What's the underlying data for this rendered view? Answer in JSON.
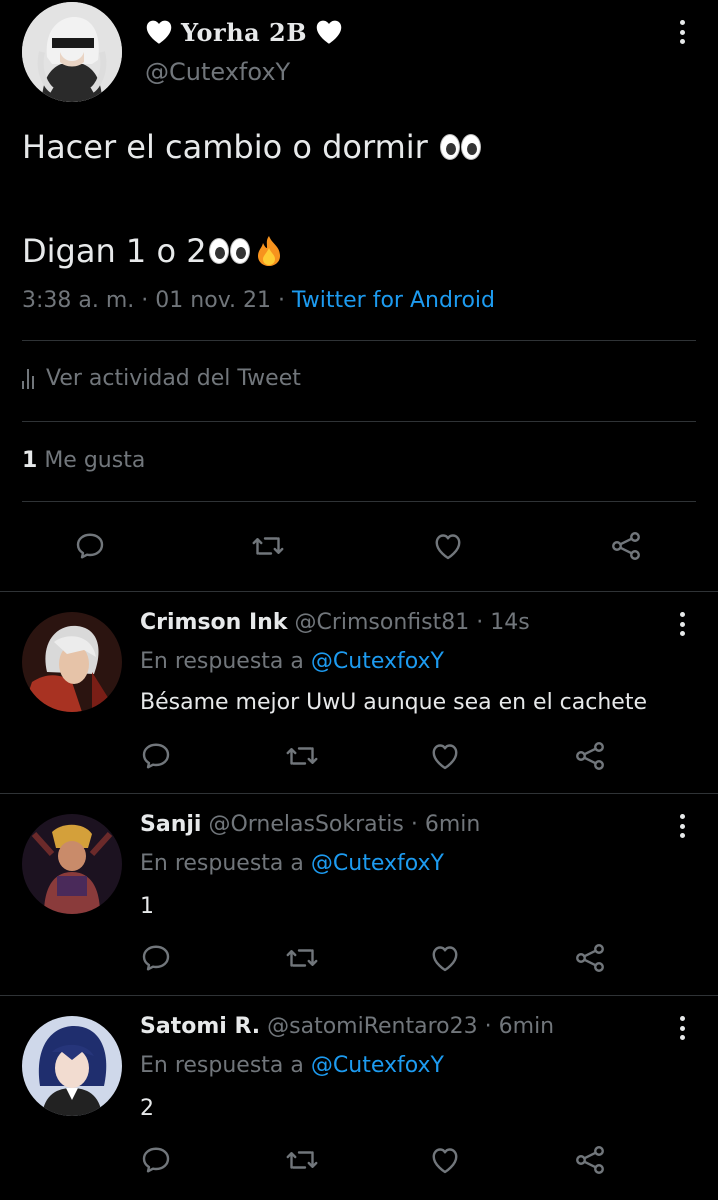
{
  "main_tweet": {
    "display_name": "Yorha 2B",
    "handle": "@CutexfoxY",
    "text_line1": "Hacer el cambio o dormir",
    "text_line2": "Digan 1 o 2",
    "time": "3:38 a. m.",
    "date": "01 nov. 21",
    "source": "Twitter for Android",
    "activity_label": "Ver actividad del Tweet",
    "likes_count": "1",
    "likes_label": "Me gusta"
  },
  "replies": [
    {
      "name": "Crimson Ink",
      "handle": "@Crimsonfist81",
      "time": "14s",
      "reply_prefix": "En respuesta a",
      "reply_to": "@CutexfoxY",
      "text": "Bésame mejor UwU aunque sea en el cachete"
    },
    {
      "name": "Sanji",
      "handle": "@OrnelasSokratis",
      "time": "6min",
      "reply_prefix": "En respuesta a",
      "reply_to": "@CutexfoxY",
      "text": "1"
    },
    {
      "name": "Satomi R.",
      "handle": "@satomiRentaro23",
      "time": "6min",
      "reply_prefix": "En respuesta a",
      "reply_to": "@CutexfoxY",
      "text": "2"
    }
  ],
  "separator": "·",
  "icons": {
    "reply": "reply-icon",
    "retweet": "retweet-icon",
    "like": "heart-icon",
    "share": "share-icon",
    "more": "more-icon",
    "activity": "bar-chart-icon"
  },
  "colors": {
    "background": "#000000",
    "text": "#e7e9ea",
    "secondary": "#71767b",
    "link": "#1d9bf0",
    "divider": "#2f3336"
  }
}
